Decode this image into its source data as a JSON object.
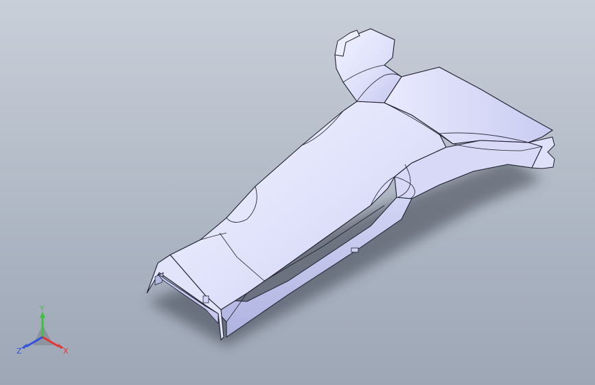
{
  "viewport": {
    "background_top": "#c9cfd9",
    "background_bottom": "#9ea7b6"
  },
  "model": {
    "face_color": "#e4e6fb",
    "face_shade": "#bcc0ea",
    "edge_color": "#1c1c2a",
    "shadow_color": "#3a3f4c"
  },
  "triad": {
    "x_label": "X",
    "y_label": "Y",
    "z_label": "Z",
    "x_color": "#e8322e",
    "y_color": "#3cc23c",
    "z_color": "#2f4fe0"
  }
}
